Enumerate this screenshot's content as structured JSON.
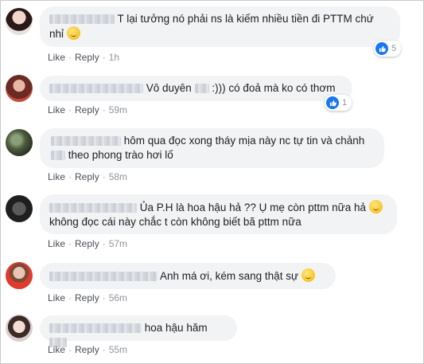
{
  "actions": {
    "like": "Like",
    "reply": "Reply",
    "sep": "·"
  },
  "comments": [
    {
      "line1": "T lại tưởng nó phải ns là kiếm nhiều tiền đi PTTM chứ",
      "line2": "nhỉ",
      "time": "1h",
      "reactions": "5"
    },
    {
      "line1_a": "Vô duyên",
      "line1_b": ":))) có đoả mà ko có thơm",
      "time": "59m",
      "reactions": "1"
    },
    {
      "line1": "hôm qua đọc xong tháy mịa này nc tự tin và chảnh",
      "line2": "theo phong trào hơi lố",
      "time": "58m"
    },
    {
      "line1": "Ủa P.H là hoa hậu hả ?? Ụ mẹ còn pttm nữa hả",
      "line2": "không đọc cái này chắc t còn không biết bã pttm nữa",
      "time": "57m"
    },
    {
      "line1": "Anh má ơi, kém sang thật sự",
      "time": "56m"
    },
    {
      "line1": "hoa hậu hăm",
      "time": "55m"
    }
  ],
  "colors": {
    "bubble": "#f2f3f5",
    "like_blue": "#1877f2",
    "meta": "#90949c"
  }
}
